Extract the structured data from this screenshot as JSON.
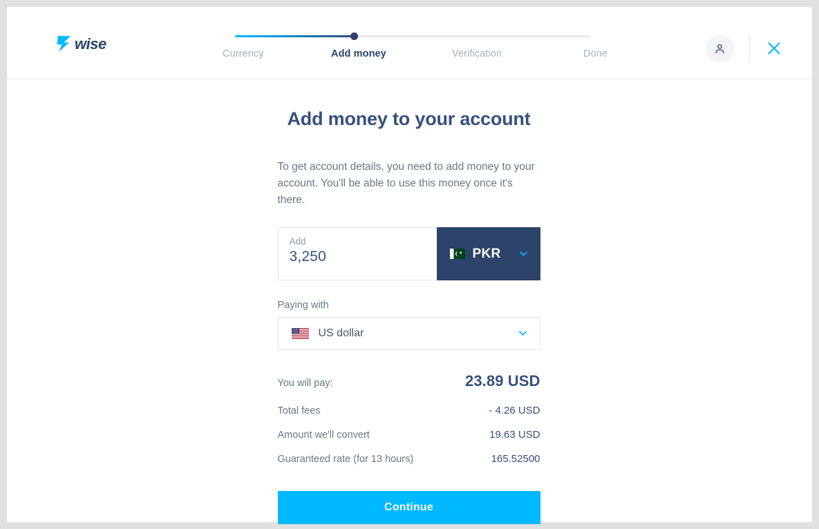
{
  "brand": {
    "logo_text": "wise",
    "accent_color": "#00b9ff",
    "navy_color": "#2e4369"
  },
  "header": {
    "avatar_icon": "person-icon",
    "close_icon": "close-icon",
    "steps": [
      {
        "label": "Currency",
        "state": "completed"
      },
      {
        "label": "Add money",
        "state": "active"
      },
      {
        "label": "Verification",
        "state": "upcoming"
      },
      {
        "label": "Done",
        "state": "upcoming"
      }
    ],
    "progress_percent": 33
  },
  "main": {
    "title": "Add money to your account",
    "intro": "To get account details, you need to add money to your account. You'll be able to use this money once it's there.",
    "amount": {
      "label": "Add",
      "value": "3,250",
      "currency_code": "PKR",
      "currency_flag": "pakistan-flag-icon",
      "chevron_icon": "chevron-down-icon"
    },
    "paying_with": {
      "label": "Paying with",
      "value": "US dollar",
      "flag": "usa-flag-icon",
      "chevron_icon": "chevron-down-icon"
    },
    "summary": [
      {
        "key": "You will pay:",
        "value": "23.89 USD"
      },
      {
        "key": "Total fees",
        "value": "- 4.26 USD"
      },
      {
        "key": "Amount we'll convert",
        "value": "19.63 USD"
      },
      {
        "key": "Guaranteed rate (for 13 hours)",
        "value": "165.52500"
      }
    ],
    "continue_label": "Continue"
  }
}
